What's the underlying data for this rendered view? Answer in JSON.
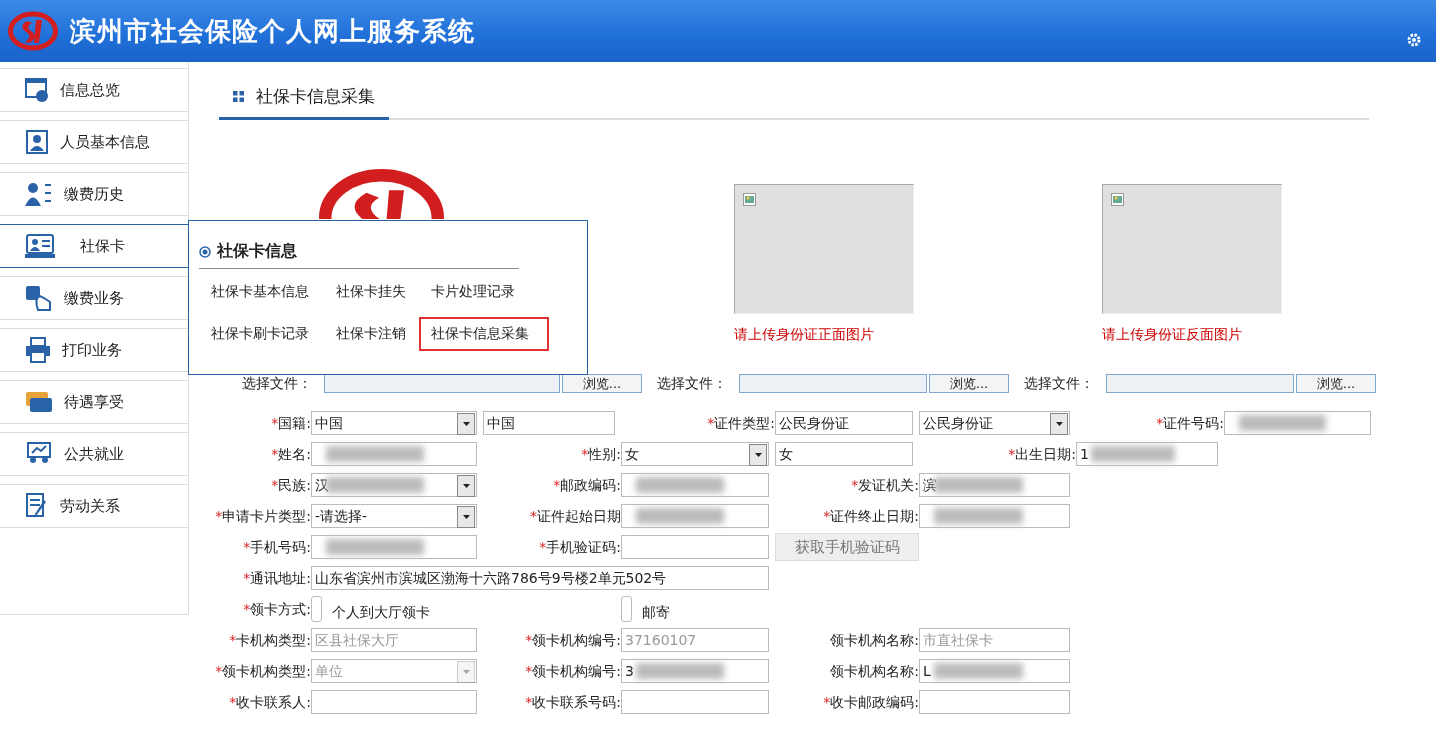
{
  "header": {
    "title": "滨州市社会保险个人网上服务系统"
  },
  "sidebar": {
    "items": [
      {
        "label": "信息总览",
        "kind": "overview",
        "selected": false
      },
      {
        "label": "人员基本信息",
        "kind": "person",
        "selected": false
      },
      {
        "label": "缴费历史",
        "kind": "history",
        "selected": false
      },
      {
        "label": "社保卡",
        "kind": "card",
        "selected": true
      },
      {
        "label": "缴费业务",
        "kind": "pay",
        "selected": false
      },
      {
        "label": "打印业务",
        "kind": "print",
        "selected": false
      },
      {
        "label": "待遇享受",
        "kind": "benefit",
        "selected": false
      },
      {
        "label": "公共就业",
        "kind": "job",
        "selected": false
      },
      {
        "label": "劳动关系",
        "kind": "labor",
        "selected": false
      }
    ]
  },
  "flyout": {
    "title": "社保卡信息",
    "links": [
      {
        "label": "社保卡基本信息",
        "highlighted": false
      },
      {
        "label": "社保卡挂失",
        "highlighted": false
      },
      {
        "label": "卡片处理记录",
        "highlighted": false
      },
      {
        "label": "社保卡刷卡记录",
        "highlighted": false
      },
      {
        "label": "社保卡注销",
        "highlighted": false
      },
      {
        "label": "社保卡信息采集",
        "highlighted": true
      }
    ]
  },
  "tab": {
    "label": "社保卡信息采集",
    "selected": true
  },
  "uploads": [
    {
      "kind": "logo"
    },
    {
      "kind": "preview",
      "caption": "请上传身份证正面图片"
    },
    {
      "kind": "preview",
      "caption": "请上传身份证反面图片"
    }
  ],
  "file_pickers": [
    {
      "label": "选择文件：",
      "button": "浏览..."
    },
    {
      "label": "选择文件：",
      "button": "浏览..."
    },
    {
      "label": "选择文件：",
      "button": "浏览..."
    }
  ],
  "form_rows": [
    [
      {
        "kind": "label",
        "mark": "*",
        "text": "国籍:"
      },
      {
        "kind": "select",
        "value": "中国"
      },
      {
        "kind": "input",
        "value": "中国"
      },
      {
        "kind": "label",
        "mark": "*",
        "text": "证件类型:"
      },
      {
        "kind": "input",
        "value": "公民身份证"
      },
      {
        "kind": "select",
        "value": "公民身份证"
      },
      {
        "kind": "label",
        "mark": "*",
        "text": "证件号码:"
      },
      {
        "kind": "input",
        "blurred": true
      }
    ],
    [
      {
        "kind": "label",
        "mark": "*",
        "text": "姓名:"
      },
      {
        "kind": "input",
        "blurred": true
      },
      {
        "kind": "label",
        "mark": "*",
        "text": "性别:"
      },
      {
        "kind": "select",
        "value": "女"
      },
      {
        "kind": "input",
        "value": "女"
      },
      {
        "kind": "label",
        "mark": "*",
        "text": "出生日期:"
      },
      {
        "kind": "input",
        "value": "1",
        "blurred": true
      }
    ],
    [
      {
        "kind": "label",
        "mark": "*",
        "text": "民族:"
      },
      {
        "kind": "select",
        "value": "汉",
        "blurred": true
      },
      {
        "kind": "label",
        "mark": "*",
        "text": "邮政编码:"
      },
      {
        "kind": "input",
        "blurred": true
      },
      {
        "kind": "label",
        "mark": "*",
        "text": "发证机关:"
      },
      {
        "kind": "input",
        "value": "滨",
        "blurred": true
      }
    ],
    [
      {
        "kind": "label",
        "mark": "*",
        "text": "申请卡片类型:"
      },
      {
        "kind": "select",
        "value": "-请选择-"
      },
      {
        "kind": "label",
        "mark": "*",
        "text": "证件起始日期"
      },
      {
        "kind": "input",
        "blurred": true
      },
      {
        "kind": "label",
        "mark": "*",
        "text": "证件终止日期:"
      },
      {
        "kind": "input",
        "blurred": true
      }
    ],
    [
      {
        "kind": "label",
        "mark": "*",
        "text": "手机号码:"
      },
      {
        "kind": "input",
        "blurred": true
      },
      {
        "kind": "label",
        "mark": "*",
        "text": "手机验证码:"
      },
      {
        "kind": "input"
      },
      {
        "kind": "button",
        "text": "获取手机验证码"
      }
    ],
    [
      {
        "kind": "label",
        "mark": "*",
        "text": "通讯地址:"
      },
      {
        "kind": "wide",
        "value": "山东省滨州市滨城区渤海十六路786号9号楼2单元502号"
      }
    ],
    [
      {
        "kind": "label",
        "mark": "*",
        "text": "领卡方式:"
      },
      {
        "kind": "radio",
        "text": "个人到大厅领卡",
        "selected": false
      },
      {
        "kind": "radio",
        "text": "邮寄",
        "selected": false
      }
    ],
    [
      {
        "kind": "label",
        "mark": "*",
        "text": "卡机构类型:"
      },
      {
        "kind": "input",
        "value": "区县社保大厅",
        "disabled": true
      },
      {
        "kind": "label",
        "mark": "*",
        "text": "领卡机构编号:"
      },
      {
        "kind": "input",
        "value": "37160107",
        "disabled": true
      },
      {
        "kind": "label",
        "text": "领卡机构名称:"
      },
      {
        "kind": "input",
        "value": "市直社保卡",
        "disabled": true
      }
    ],
    [
      {
        "kind": "label",
        "mark": "*",
        "text": "领卡机构类型:"
      },
      {
        "kind": "select",
        "value": "单位",
        "disabled": true
      },
      {
        "kind": "label",
        "mark": "*",
        "text": "领卡机构编号:"
      },
      {
        "kind": "input",
        "value": "3",
        "blurred": true
      },
      {
        "kind": "label",
        "text": "领卡机构名称:"
      },
      {
        "kind": "input",
        "value": "L",
        "blurred": true
      }
    ],
    [
      {
        "kind": "label",
        "mark": "*",
        "text": "收卡联系人:"
      },
      {
        "kind": "input"
      },
      {
        "kind": "label",
        "mark": "*",
        "text": "收卡联系号码:"
      },
      {
        "kind": "input"
      },
      {
        "kind": "label",
        "mark": "*",
        "text": "收卡邮政编码:"
      },
      {
        "kind": "input"
      }
    ]
  ]
}
